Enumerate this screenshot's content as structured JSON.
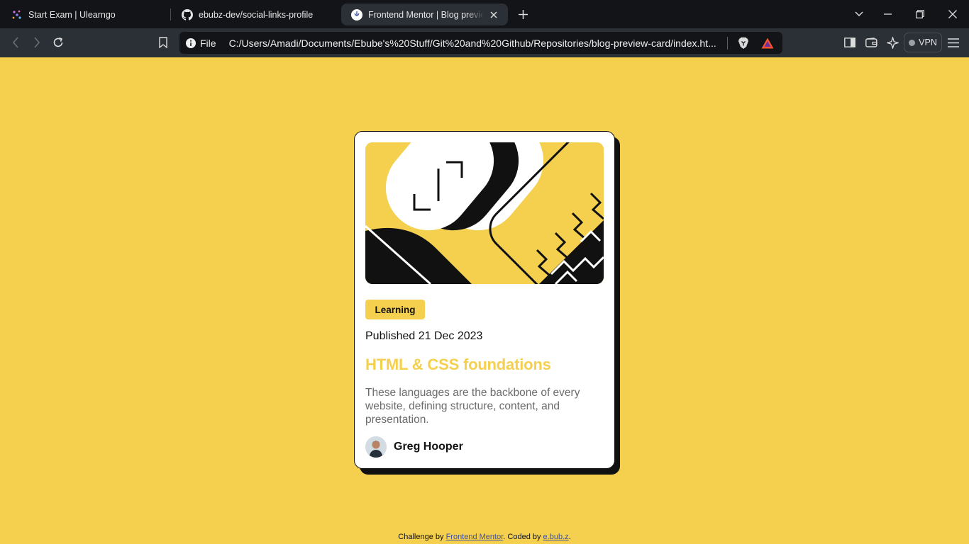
{
  "browser": {
    "tabs": [
      {
        "title": "Start Exam | Ulearngo",
        "icon": "ulearngo-icon"
      },
      {
        "title": "ebubz-dev/social-links-profile",
        "icon": "github-icon"
      },
      {
        "title": "Frontend Mentor | Blog preview card",
        "icon": "frontend-mentor-icon",
        "active": true
      }
    ],
    "url_scheme": "File",
    "url": "C:/Users/Amadi/Documents/Ebube's%20Stuff/Git%20and%20Github/Repositories/blog-preview-card/index.ht...",
    "vpn_label": "VPN"
  },
  "card": {
    "tag": "Learning",
    "published": "Published 21 Dec 2023",
    "title": "HTML & CSS foundations",
    "description": "These languages are the backbone of every website, defining structure, content, and presentation.",
    "author": "Greg Hooper"
  },
  "footer": {
    "prefix": "Challenge by ",
    "link1": "Frontend Mentor",
    "middle": ". Coded by ",
    "link2": "e.bub.z",
    "suffix": "."
  },
  "colors": {
    "background": "#f4d04e",
    "card": "#ffffff",
    "ink": "#111111",
    "muted": "#6b6b6b",
    "link": "#3e52a3"
  }
}
